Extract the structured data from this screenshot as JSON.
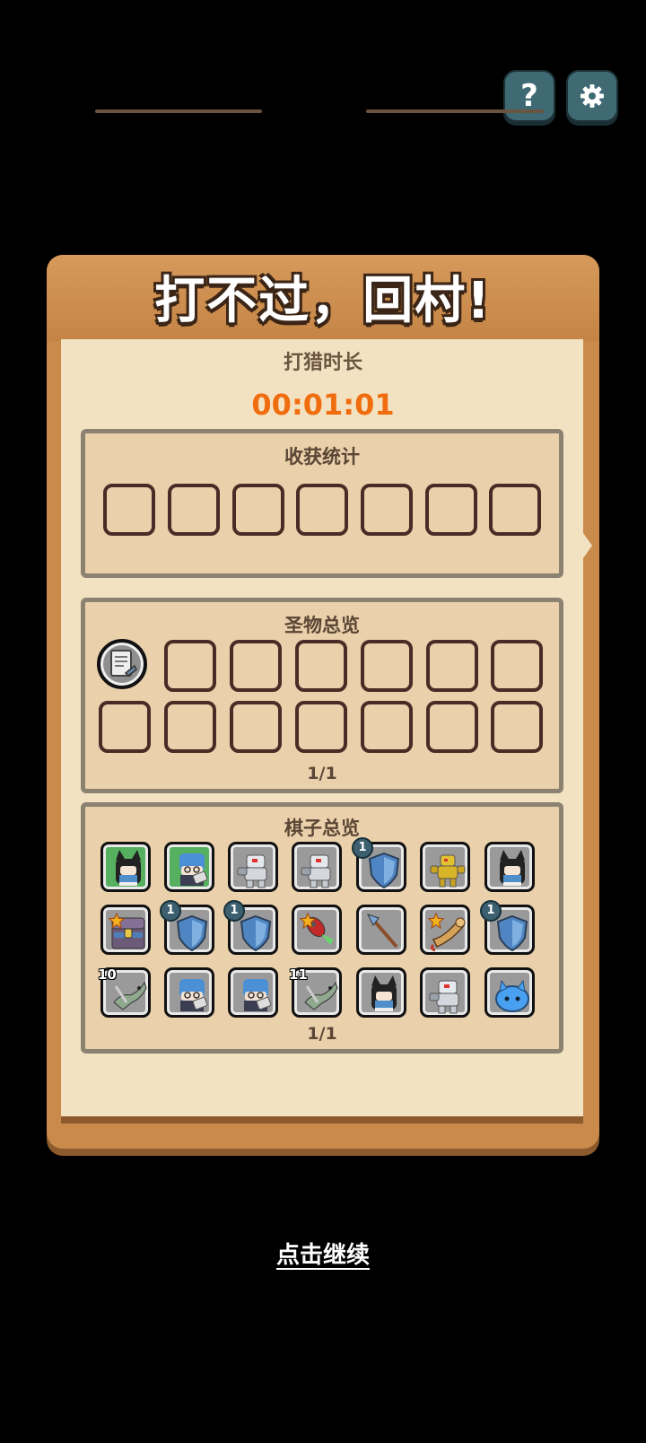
{
  "top_buttons": {
    "help_label": "?"
  },
  "title": "打不过，回村!",
  "hunt": {
    "label": "打猎时长",
    "time": "00:01:01"
  },
  "harvest": {
    "title": "收获统计",
    "slots": 7
  },
  "relics": {
    "title": "圣物总览",
    "page": "1/1"
  },
  "pieces": {
    "title": "棋子总览",
    "page": "1/1",
    "rows": [
      [
        {
          "icon": "catgirl-icon",
          "bg": "green",
          "badge": "",
          "lvl": "",
          "star": false
        },
        {
          "icon": "blue-mage-icon",
          "bg": "green",
          "badge": "",
          "lvl": "",
          "star": false
        },
        {
          "icon": "robot-icon",
          "bg": "gray",
          "badge": "",
          "lvl": "",
          "star": false
        },
        {
          "icon": "robot-icon",
          "bg": "gray",
          "badge": "",
          "lvl": "",
          "star": false
        },
        {
          "icon": "shield-icon",
          "bg": "gray",
          "badge": "1",
          "lvl": "",
          "star": false
        },
        {
          "icon": "gold-robot-icon",
          "bg": "gray",
          "badge": "",
          "lvl": "",
          "star": false
        },
        {
          "icon": "catgirl-icon",
          "bg": "gray",
          "badge": "",
          "lvl": "",
          "star": false
        }
      ],
      [
        {
          "icon": "treasure-chest-icon",
          "bg": "gray",
          "badge": "",
          "lvl": "",
          "star": true
        },
        {
          "icon": "shield-icon",
          "bg": "gray",
          "badge": "1",
          "lvl": "",
          "star": false
        },
        {
          "icon": "shield-icon",
          "bg": "gray",
          "badge": "1",
          "lvl": "",
          "star": false
        },
        {
          "icon": "rocket-icon",
          "bg": "gray",
          "badge": "",
          "lvl": "",
          "star": true
        },
        {
          "icon": "spear-icon",
          "bg": "gray",
          "badge": "",
          "lvl": "",
          "star": false
        },
        {
          "icon": "horn-icon",
          "bg": "gray",
          "badge": "",
          "lvl": "",
          "star": true
        },
        {
          "icon": "shield-icon",
          "bg": "gray",
          "badge": "1",
          "lvl": "",
          "star": false
        }
      ],
      [
        {
          "icon": "lizard-icon",
          "bg": "gray",
          "badge": "",
          "lvl": "10",
          "star": false
        },
        {
          "icon": "blue-mage-icon",
          "bg": "gray",
          "badge": "",
          "lvl": "",
          "star": false
        },
        {
          "icon": "blue-mage-icon",
          "bg": "gray",
          "badge": "",
          "lvl": "",
          "star": false
        },
        {
          "icon": "lizard-icon",
          "bg": "gray",
          "badge": "",
          "lvl": "11",
          "star": false
        },
        {
          "icon": "catgirl-icon",
          "bg": "gray",
          "badge": "",
          "lvl": "",
          "star": false
        },
        {
          "icon": "robot-icon",
          "bg": "gray",
          "badge": "",
          "lvl": "",
          "star": false
        },
        {
          "icon": "blue-slime-icon",
          "bg": "gray",
          "badge": "",
          "lvl": "",
          "star": false
        }
      ]
    ]
  },
  "continue_label": "点击继续"
}
